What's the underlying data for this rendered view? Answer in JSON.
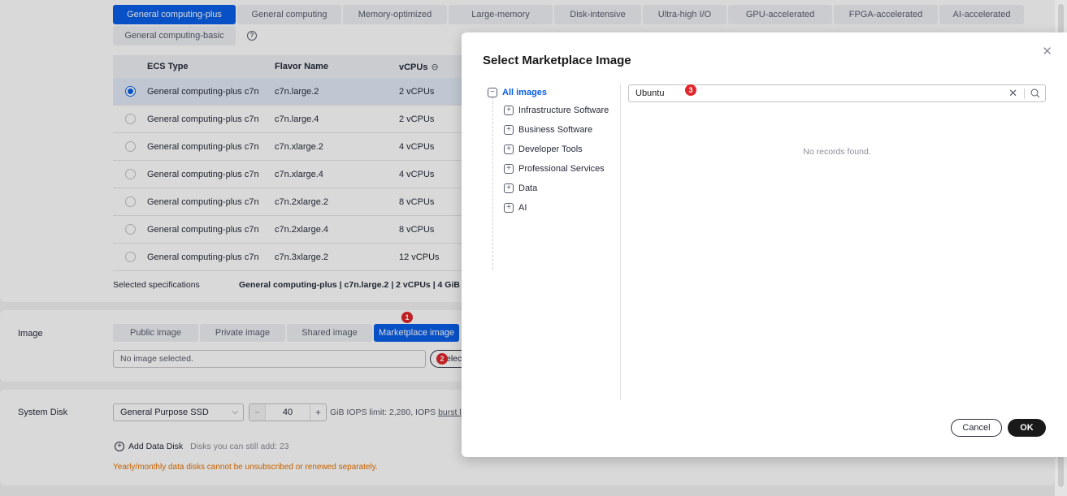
{
  "flavor_tabs": [
    "General computing-plus",
    "General computing",
    "Memory-optimized",
    "Large-memory",
    "Disk-intensive",
    "Ultra-high I/O",
    "GPU-accelerated",
    "FPGA-accelerated",
    "AI-accelerated"
  ],
  "flavor_tab_basic": "General computing-basic",
  "help_icon": "?",
  "table": {
    "headers": [
      "ECS Type",
      "Flavor Name",
      "vCPUs"
    ],
    "sort_icon": "⊖",
    "rows": [
      {
        "type": "General computing-plus c7n",
        "flavor": "c7n.large.2",
        "vcpus": "2 vCPUs"
      },
      {
        "type": "General computing-plus c7n",
        "flavor": "c7n.large.4",
        "vcpus": "2 vCPUs"
      },
      {
        "type": "General computing-plus c7n",
        "flavor": "c7n.xlarge.2",
        "vcpus": "4 vCPUs"
      },
      {
        "type": "General computing-plus c7n",
        "flavor": "c7n.xlarge.4",
        "vcpus": "4 vCPUs"
      },
      {
        "type": "General computing-plus c7n",
        "flavor": "c7n.2xlarge.2",
        "vcpus": "8 vCPUs"
      },
      {
        "type": "General computing-plus c7n",
        "flavor": "c7n.2xlarge.4",
        "vcpus": "8 vCPUs"
      },
      {
        "type": "General computing-plus c7n",
        "flavor": "c7n.3xlarge.2",
        "vcpus": "12 vCPUs"
      }
    ],
    "selected_index": 0
  },
  "selected_spec": {
    "label": "Selected specifications",
    "value": "General computing-plus | c7n.large.2 | 2 vCPUs | 4 GiB"
  },
  "image": {
    "label": "Image",
    "tabs": [
      "Public image",
      "Private image",
      "Shared image",
      "Marketplace image"
    ],
    "active_tab": "Marketplace image",
    "placeholder": "No image selected.",
    "select_button": "Select"
  },
  "system_disk": {
    "label": "System Disk",
    "type": "General Purpose SSD",
    "chevron": "⌵",
    "minus": "−",
    "size": "40",
    "plus": "+",
    "unit": "GiB IOPS limit: 2,280, IOPS",
    "burst": "burst limit"
  },
  "data_disk": {
    "add_label": "Add Data Disk",
    "plus_icon": "+",
    "remaining": "Disks you can still add: 23",
    "warning": "Yearly/monthly data disks cannot be unsubscribed or renewed separately."
  },
  "badges": {
    "one": "1",
    "two": "2",
    "three": "3"
  },
  "modal": {
    "title": "Select Marketplace Image",
    "close_icon": "✕",
    "tree_root": "All images",
    "collapse_icon": "−",
    "expand_icon": "+",
    "categories": [
      "Infrastructure Software",
      "Business Software",
      "Developer Tools",
      "Professional Services",
      "Data",
      "AI"
    ],
    "search_value": "Ubuntu",
    "clear_icon": "✕",
    "empty_text": "No records found.",
    "cancel": "Cancel",
    "ok": "OK"
  },
  "colors": {
    "accent": "#0a5fe8",
    "badge": "#e0262b",
    "warning": "#e87400",
    "ok_button": "#191919"
  }
}
